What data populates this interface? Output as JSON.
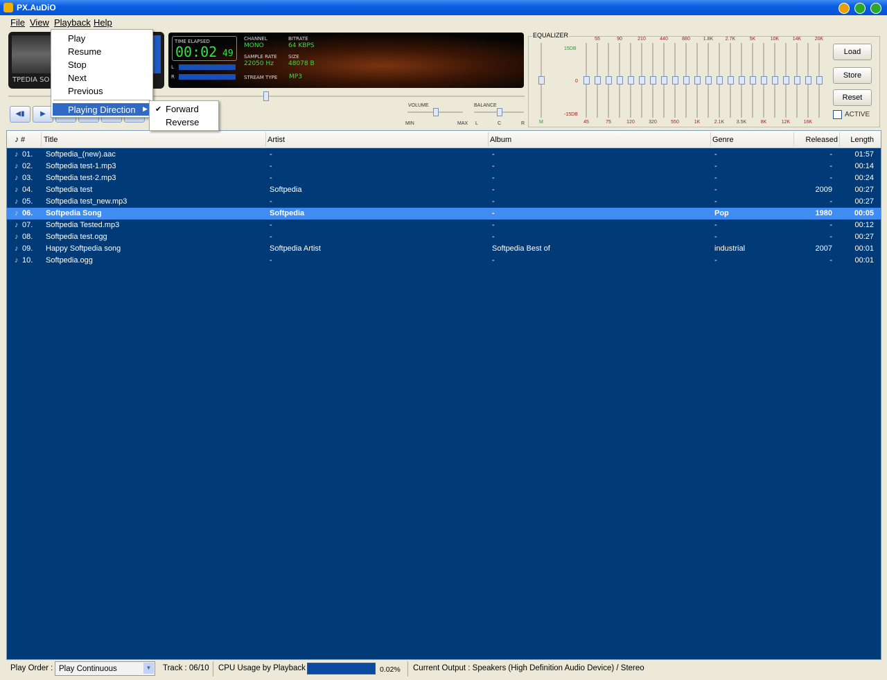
{
  "window": {
    "title": "PX.AuDiO"
  },
  "menubar": {
    "items": [
      "File",
      "View",
      "Playback",
      "Help"
    ]
  },
  "deck": {
    "label": "TPEDIA SO"
  },
  "display": {
    "time_label": "TIME ELAPSED",
    "time": "00:02",
    "time_frac": "49",
    "channel_label": "CHANNEL",
    "channel": "MONO",
    "bitrate_label": "BITRATE",
    "bitrate": "64 KBPS",
    "sample_rate_label": "SAMPLE RATE",
    "sample_rate": "22050 Hz",
    "size_label": "SIZE",
    "size": "48078 B",
    "stream_type_label": "STREAM TYPE",
    "stream_type": "MP3",
    "meter_l": "L",
    "meter_r": "R"
  },
  "controls": {
    "volume_label": "VOLUME",
    "volume_min": "MIN",
    "volume_max": "MAX",
    "balance_label": "BALANCE",
    "balance_l": "L",
    "balance_c": "C",
    "balance_r": "R",
    "volume": 0.5,
    "balance": 0.5
  },
  "equalizer": {
    "title": "EQUALIZER",
    "db_top": "15DB",
    "db_mid": "0",
    "db_bottom": "-15DB",
    "bands_top": [
      "55",
      "90",
      "210",
      "440",
      "880",
      "1.8K",
      "2.7K",
      "5K",
      "10K",
      "14K",
      "20K"
    ],
    "bands_bottom": [
      "45",
      "75",
      "120",
      "320",
      "550",
      "1K",
      "2.1K",
      "3.5K",
      "8K",
      "12K",
      "16K"
    ],
    "master_label": "M",
    "buttons": {
      "load": "Load",
      "store": "Store",
      "reset": "Reset"
    },
    "active_label": "ACTIVE"
  },
  "playback_menu": {
    "items": [
      "Play",
      "Resume",
      "Stop",
      "Next",
      "Previous"
    ],
    "playing_direction": "Playing Direction",
    "submenu": {
      "forward": "Forward",
      "reverse": "Reverse",
      "checked": "Forward"
    }
  },
  "playlist": {
    "columns": [
      "#",
      "Title",
      "Artist",
      "Album",
      "Genre",
      "Released",
      "Length"
    ],
    "rows": [
      {
        "num": "01.",
        "title": "Softpedia_(new).aac",
        "artist": "-",
        "album": "-",
        "genre": "-",
        "released": "-",
        "length": "01:57"
      },
      {
        "num": "02.",
        "title": "Softpedia test-1.mp3",
        "artist": "-",
        "album": "-",
        "genre": "-",
        "released": "-",
        "length": "00:14"
      },
      {
        "num": "03.",
        "title": "Softpedia test-2.mp3",
        "artist": "-",
        "album": "-",
        "genre": "-",
        "released": "-",
        "length": "00:24"
      },
      {
        "num": "04.",
        "title": "Softpedia test",
        "artist": "Softpedia",
        "album": "-",
        "genre": "-",
        "released": "2009",
        "length": "00:27"
      },
      {
        "num": "05.",
        "title": "Softpedia test_new.mp3",
        "artist": "-",
        "album": "-",
        "genre": "-",
        "released": "-",
        "length": "00:27"
      },
      {
        "num": "06.",
        "title": "Softpedia Song",
        "artist": "Softpedia",
        "album": "-",
        "genre": "Pop",
        "released": "1980",
        "length": "00:05"
      },
      {
        "num": "07.",
        "title": "Softpedia Tested.mp3",
        "artist": "-",
        "album": "-",
        "genre": "-",
        "released": "-",
        "length": "00:12"
      },
      {
        "num": "08.",
        "title": "Softpedia test.ogg",
        "artist": "-",
        "album": "-",
        "genre": "-",
        "released": "-",
        "length": "00:27"
      },
      {
        "num": "09.",
        "title": "Happy Softpedia song",
        "artist": "Softpedia Artist",
        "album": "Softpedia Best of",
        "genre": "industrial",
        "released": "2007",
        "length": "00:01"
      },
      {
        "num": "10.",
        "title": "Softpedia.ogg",
        "artist": "-",
        "album": "-",
        "genre": "-",
        "released": "-",
        "length": "00:01"
      }
    ],
    "selected_index": 5
  },
  "statusbar": {
    "play_order_label": "Play Order :",
    "play_order_value": "Play Continuous",
    "track": "Track : 06/10",
    "cpu_label": "CPU Usage by Playback :",
    "cpu_value": "0.02%",
    "output": "Current Output : Speakers (High Definition Audio Device) / Stereo"
  },
  "colors": {
    "accent": "#316ac5",
    "playlist_bg": "#003a77",
    "lcd_green": "#36e14b",
    "selected_row": "#3f8cf3"
  }
}
